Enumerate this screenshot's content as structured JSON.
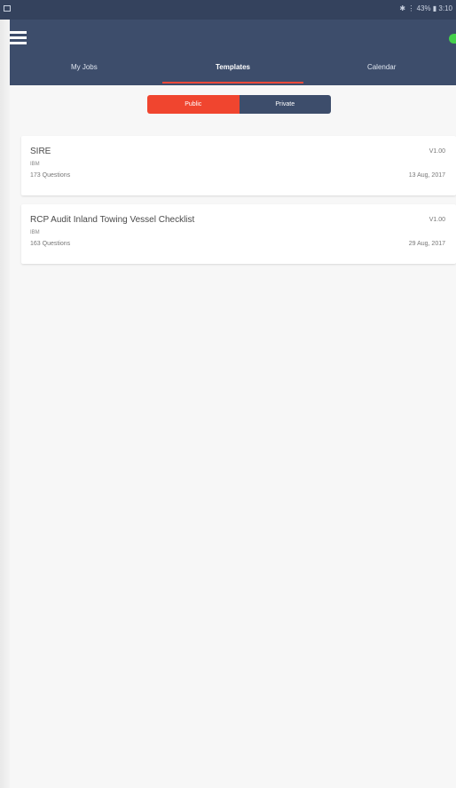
{
  "status_bar": {
    "left_icon": "image-icon",
    "right_text": "✱ ⋮ 43% ▮ 3:10"
  },
  "header": {
    "menu_icon": "hamburger-menu-icon",
    "tabs": [
      {
        "label": "My Jobs"
      },
      {
        "label": "Templates"
      },
      {
        "label": "Calendar"
      }
    ],
    "active_tab": "Templates"
  },
  "segmented_control": {
    "options": [
      {
        "label": "Public"
      },
      {
        "label": "Private"
      }
    ],
    "selected": "Public"
  },
  "templates": [
    {
      "title": "SIRE",
      "version": "V1.00",
      "owner": "IBM",
      "questions": "173 Questions",
      "date": "13 Aug, 2017"
    },
    {
      "title": "RCP Audit Inland Towing Vessel Checklist",
      "version": "V1.00",
      "owner": "IBM",
      "questions": "163 Questions",
      "date": "29 Aug, 2017"
    }
  ],
  "colors": {
    "header_bg": "#3d4d6b",
    "accent": "#f14a3a",
    "public_segment": "#f0452f",
    "online_status": "#44d04b"
  }
}
